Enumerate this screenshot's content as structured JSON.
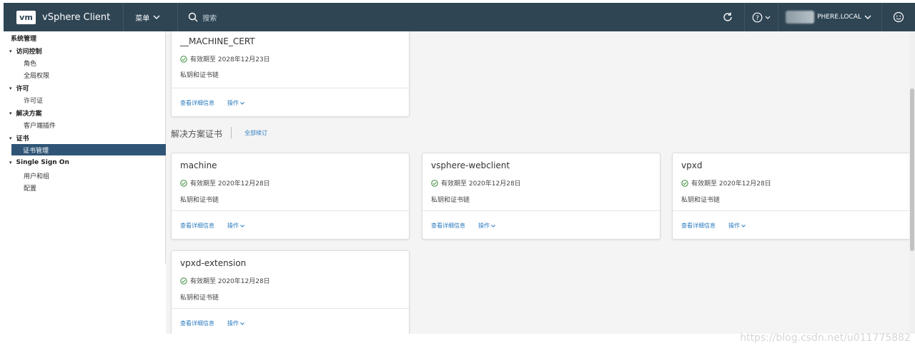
{
  "header": {
    "logo": "vm",
    "title": "vSphere Client",
    "menu_label": "菜单",
    "search_placeholder": "搜索",
    "user": "PHERE.LOCAL"
  },
  "sidebar": {
    "heading": "系统管理",
    "groups": [
      {
        "label": "访问控制",
        "items": [
          "角色",
          "全局权限"
        ]
      },
      {
        "label": "许可",
        "items": [
          "许可证"
        ]
      },
      {
        "label": "解决方案",
        "items": [
          "客户端插件"
        ]
      },
      {
        "label": "证书",
        "items": [
          "证书管理"
        ]
      },
      {
        "label": "Single Sign On",
        "items": [
          "用户和组",
          "配置"
        ]
      }
    ]
  },
  "main": {
    "section_title": "解决方案证书",
    "renew_all": "全部续订",
    "common": {
      "chain": "私钥和证书链",
      "details": "查看详细信息",
      "actions": "操作"
    },
    "cards": [
      {
        "title": "__MACHINE_CERT",
        "valid": "有效期至 2028年12月23日"
      },
      {
        "title": "machine",
        "valid": "有效期至 2020年12月28日"
      },
      {
        "title": "vsphere-webclient",
        "valid": "有效期至 2020年12月28日"
      },
      {
        "title": "vpxd",
        "valid": "有效期至 2020年12月28日"
      },
      {
        "title": "vpxd-extension",
        "valid": "有效期至 2020年12月28日"
      }
    ]
  },
  "watermark": "https://blog.csdn.net/u011775882",
  "colors": {
    "header": "#2f4554",
    "selected": "#2f5576",
    "link": "#2b7bbf",
    "valid_icon": "#3c8d3c"
  }
}
